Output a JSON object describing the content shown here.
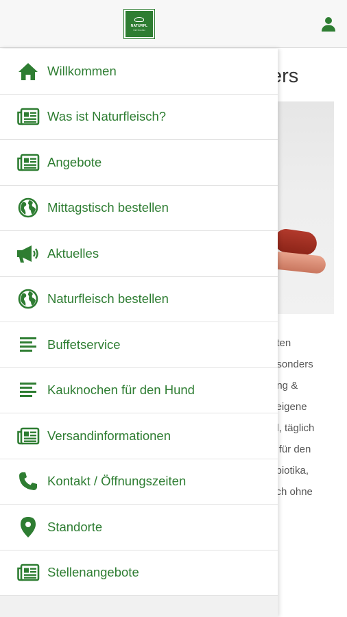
{
  "header": {
    "logo_text": "NATURFL",
    "logo_sub": "METZGEREI"
  },
  "background_page": {
    "heading": "ers",
    "lines": [
      "eten",
      "esonders",
      "ung &",
      "seigene",
      "hl, täglich",
      "s für den",
      "tibiotika,",
      "sch ohne"
    ]
  },
  "menu": {
    "items": [
      {
        "label": "Willkommen",
        "icon": "home-icon"
      },
      {
        "label": "Was ist Naturfleisch?",
        "icon": "newspaper-icon"
      },
      {
        "label": "Angebote",
        "icon": "newspaper-icon"
      },
      {
        "label": "Mittagstisch bestellen",
        "icon": "globe-icon"
      },
      {
        "label": "Aktuelles",
        "icon": "megaphone-icon"
      },
      {
        "label": "Naturfleisch bestellen",
        "icon": "globe-icon"
      },
      {
        "label": "Buffetservice",
        "icon": "lines-icon"
      },
      {
        "label": "Kauknochen für den Hund",
        "icon": "lines-icon"
      },
      {
        "label": "Versandinformationen",
        "icon": "newspaper-icon"
      },
      {
        "label": "Kontakt / Öffnungszeiten",
        "icon": "phone-icon"
      },
      {
        "label": "Standorte",
        "icon": "map-pin-icon"
      },
      {
        "label": "Stellenangebote",
        "icon": "newspaper-icon"
      }
    ]
  },
  "colors": {
    "accent": "#2e7d32",
    "header_bg": "#f7f7f7",
    "drawer_bg": "#ffffff"
  }
}
